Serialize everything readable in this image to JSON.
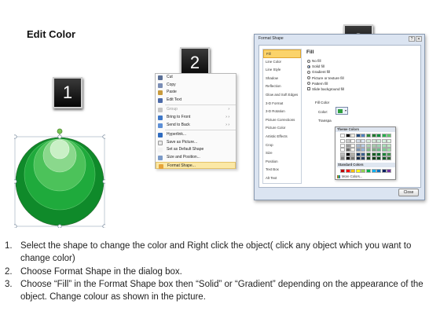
{
  "title": "Edit Color",
  "steps": [
    "1",
    "2",
    "3"
  ],
  "context_menu": {
    "items": [
      {
        "label": "Cut",
        "icon": "scissors-icon",
        "disabled": false
      },
      {
        "label": "Copy",
        "icon": "copy-icon",
        "disabled": false
      },
      {
        "label": "Paste",
        "icon": "paste-icon",
        "disabled": false
      },
      {
        "label": "Edit Text",
        "icon": "edit-text-icon",
        "disabled": false
      },
      {
        "label": "Group",
        "icon": "group-icon",
        "disabled": true,
        "submenu": true
      },
      {
        "label": "Bring to Front",
        "icon": "bring-front-icon",
        "disabled": false,
        "submenu": true
      },
      {
        "label": "Send to Back",
        "icon": "send-back-icon",
        "disabled": false,
        "submenu": true
      },
      {
        "label": "Hyperlink...",
        "icon": "hyperlink-icon",
        "disabled": false
      },
      {
        "label": "Save as Picture...",
        "icon": "save-picture-icon",
        "disabled": false
      },
      {
        "label": "Set as Default Shape",
        "icon": "default-shape-icon",
        "disabled": false
      },
      {
        "label": "Size and Position...",
        "icon": "size-position-icon",
        "disabled": false
      },
      {
        "label": "Format Shape...",
        "icon": "format-shape-icon",
        "disabled": false,
        "highlighted": true
      }
    ]
  },
  "dialog": {
    "title": "Format Shape",
    "nav": [
      "Fill",
      "Line Color",
      "Line Style",
      "Shadow",
      "Reflection",
      "Glow and Soft Edges",
      "3-D Format",
      "3-D Rotation",
      "Picture Corrections",
      "Picture Color",
      "Artistic Effects",
      "Crop",
      "Size",
      "Position",
      "Text Box",
      "Alt Text"
    ],
    "panel_title": "Fill",
    "options": [
      {
        "label": "No fill",
        "on": false
      },
      {
        "label": "Solid fill",
        "on": true
      },
      {
        "label": "Gradient fill",
        "on": false
      },
      {
        "label": "Picture or texture fill",
        "on": false
      },
      {
        "label": "Pattern fill",
        "on": false
      }
    ],
    "slide_bg": "Slide background fill",
    "fill_color_label": "Fill Color",
    "color_label": "Color:",
    "transparency_label": "Transpa",
    "theme_colors_label": "Theme Colors",
    "standard_colors_label": "Standard Colors",
    "more_colors_label": "More Colors...",
    "close_label": "Close",
    "selected_color": "#2f9e3f",
    "theme_top_row": [
      "#ffffff",
      "#000000",
      "#eeece1",
      "#1f497d",
      "#4f81bd",
      "#2e8b3a",
      "#1f7a2e",
      "#0b8f3c",
      "#24b04b",
      "#5cc86a"
    ],
    "standard_colors": [
      "#c00000",
      "#ff0000",
      "#ffc000",
      "#ffff00",
      "#92d050",
      "#00b050",
      "#00b0f0",
      "#0070c0",
      "#002060",
      "#7030a0"
    ]
  },
  "instructions": [
    {
      "num": "1.",
      "text": "Select the shape to change the color and Right click the object( click any object which you want to change color)"
    },
    {
      "num": "2.",
      "text": "Choose Format Shape in the dialog box."
    },
    {
      "num": "3.",
      "text": "Choose “Fill” in the Format Shape box then “Solid” or “Gradient” depending on the appearance of the object. Change colour as shown in the picture."
    }
  ]
}
